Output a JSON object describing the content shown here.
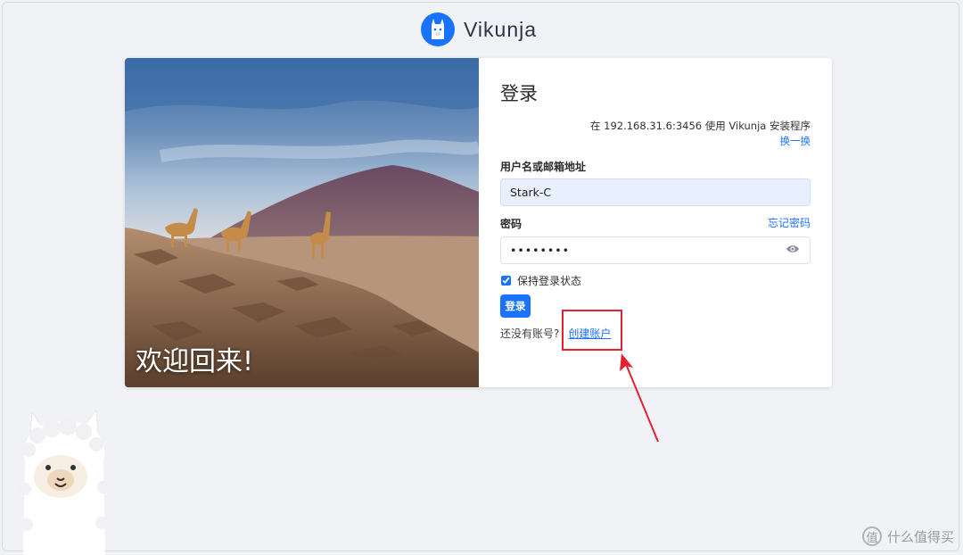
{
  "brand": {
    "name": "Vikunja",
    "color": "#1973ff"
  },
  "hero": {
    "title": "欢迎回来!"
  },
  "login": {
    "title": "登录",
    "install_info": "在 192.168.31.6:3456 使用 Vikunja 安装程序",
    "switch_label": "换一换",
    "username_label": "用户名或邮箱地址",
    "username_value": "Stark-C",
    "password_label": "密码",
    "forgot_label": "忘记密码",
    "password_value": "••••••••",
    "remember_label": "保持登录状态",
    "remember_checked": true,
    "submit_label": "登录",
    "no_account_text": "还没有账号?",
    "register_label": "创建账户"
  },
  "annotation": {
    "color": "#e32130"
  },
  "watermark": {
    "text": "什么值得买",
    "logo_glyph": "值"
  }
}
